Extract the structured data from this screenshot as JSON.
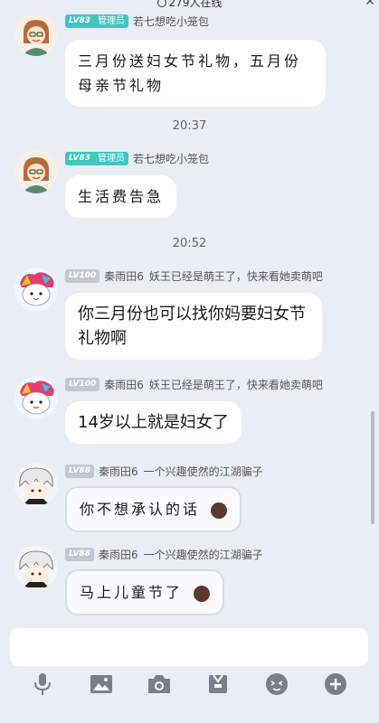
{
  "header": {
    "online_text": "279人在线"
  },
  "messages": [
    {
      "level": "LV83",
      "role": "管理员",
      "nickname": "若七想吃小笼包",
      "title": "",
      "text": "三月份送妇女节礼物，五月份母亲节礼物"
    },
    {
      "level": "LV83",
      "role": "管理员",
      "nickname": "若七想吃小笼包",
      "title": "",
      "text": "生活费告急"
    },
    {
      "level": "LV100",
      "role": "",
      "nickname": "秦雨田6",
      "title": "妖王已经是萌王了，快来看她卖萌吧",
      "text": "你三月份也可以找你妈要妇女节礼物啊"
    },
    {
      "level": "LV100",
      "role": "",
      "nickname": "秦雨田6",
      "title": "妖王已经是萌王了，快来看她卖萌吧",
      "text": "14岁以上就是妇女了"
    },
    {
      "level": "LV88",
      "role": "",
      "nickname": "秦雨田6",
      "title": "一个兴趣使然的江湖骗子",
      "text": "你不想承认的话"
    },
    {
      "level": "LV88",
      "role": "",
      "nickname": "秦雨田6",
      "title": "一个兴趣使然的江湖骗子",
      "text": "马上儿童节了"
    }
  ],
  "timestamps": [
    "20:37",
    "20:52"
  ],
  "toolbar": {
    "icons": [
      "microphone-icon",
      "image-icon",
      "camera-icon",
      "gift-icon",
      "emoji-icon",
      "plus-icon"
    ]
  },
  "colors": {
    "background": "#e9edf4",
    "admin_badge": "#3fc7c0",
    "level_badge": "#c3c7cf"
  }
}
